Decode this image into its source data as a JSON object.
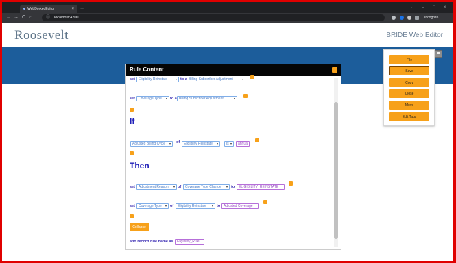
{
  "browser": {
    "tab_title": "WebDorkedEditor",
    "tab_close": "×",
    "new_tab": "+",
    "url": "localhost:4200",
    "incognito_label": "Incognito",
    "nav": {
      "back": "←",
      "forward": "→",
      "reload": "C",
      "home": "⌂",
      "info": "ⓘ"
    },
    "window": {
      "chevron": "⌄",
      "minimize": "–",
      "restore": "□",
      "close": "×"
    }
  },
  "header": {
    "logo": "Roosevelt",
    "editor_title": "BRIDE Web Editor"
  },
  "panel": {
    "title": "Rule Content"
  },
  "rule": {
    "line1": {
      "set": "set",
      "field": "Eligibility Reinstate",
      "to": "to a",
      "target": "Billing Subscriber Adjustment"
    },
    "line2": {
      "set": "set",
      "field": "Coverage Type",
      "to": "to a",
      "target": "Billing Subscriber Adjustment"
    },
    "if_label": "If",
    "cond": {
      "field": "Adjusted Billing Cycle",
      "of": "of",
      "source": "Eligibility Reinstate",
      "op": "is",
      "value": "annual"
    },
    "then_label": "Then",
    "act1": {
      "set": "set",
      "field": "Adjustment Reason",
      "of": "of",
      "source": "Coverage Type Change",
      "to": "to",
      "value": "ELIGIBILITY_REINSTATE"
    },
    "act2": {
      "set": "set",
      "field": "Coverage Type",
      "of": "of",
      "source": "Eligibility Reinstate",
      "to": "to",
      "value": "Adjusted Coverage"
    },
    "collapse": "Collapse",
    "record_label": "and record rule name as",
    "record_value": "Eligibility_Rule"
  },
  "menu": {
    "items": [
      "File",
      "Save",
      "Copy",
      "Close",
      "Move",
      "Edit Tags"
    ]
  },
  "colors": {
    "banner": "#1c5d9b",
    "accent": "#f7a11a",
    "keyword": "#2020b8",
    "border": "#e00000"
  }
}
